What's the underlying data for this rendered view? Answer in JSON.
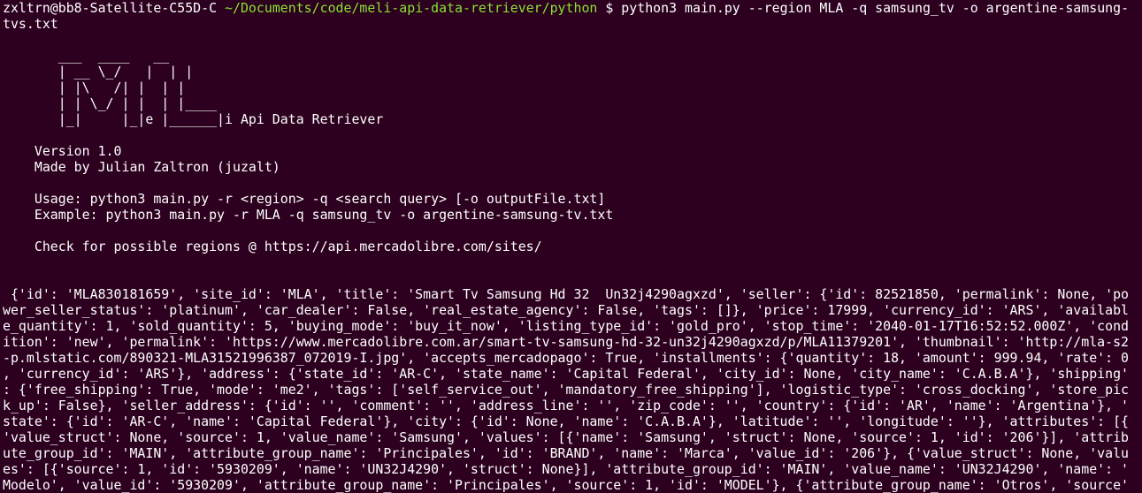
{
  "terminal": {
    "prompt_user_host": "zxltrn@bb8-Satellite-C55D-C",
    "prompt_path": "~/Documents/code/meli-api-data-retriever/python",
    "prompt_symbol": "$",
    "command": "python3 main.py --region MLA -q samsung_tv -o argentine-samsung-",
    "command_wrap": "tvs.txt",
    "banner": [
      "       ___  ____   __",
      "       | __ \\_/   |  | |",
      "       | |\\   /| |  | |",
      "       | | \\_/ | |  | |____",
      "       |_|     |_|e |______|i Api Data Retriever"
    ],
    "version": "    Version 1.0",
    "author": "    Made by Julian Zaltron (juzalt)",
    "usage": "    Usage: python3 main.py -r <region> -q <search query> [-o outputFile.txt]",
    "example": "    Example: python3 main.py -r MLA -q samsung_tv -o argentine-samsung-tv.txt",
    "regions_hint": "    Check for possible regions @ https://api.mercadolibre.com/sites/",
    "output_lines": [
      " {'id': 'MLA830181659', 'site_id': 'MLA', 'title': 'Smart Tv Samsung Hd 32  Un32j4290agxzd', 'seller': {'id': 82521850, 'permalink': None, 'po",
      "wer_seller_status': 'platinum', 'car_dealer': False, 'real_estate_agency': False, 'tags': []}, 'price': 17999, 'currency_id': 'ARS', 'availabl",
      "e_quantity': 1, 'sold_quantity': 5, 'buying_mode': 'buy_it_now', 'listing_type_id': 'gold_pro', 'stop_time': '2040-01-17T16:52:52.000Z', 'cond",
      "ition': 'new', 'permalink': 'https://www.mercadolibre.com.ar/smart-tv-samsung-hd-32-un32j4290agxzd/p/MLA11379201', 'thumbnail': 'http://mla-s2",
      "-p.mlstatic.com/890321-MLA31521996387_072019-I.jpg', 'accepts_mercadopago': True, 'installments': {'quantity': 18, 'amount': 999.94, 'rate': 0",
      ", 'currency_id': 'ARS'}, 'address': {'state_id': 'AR-C', 'state_name': 'Capital Federal', 'city_id': None, 'city_name': 'C.A.B.A'}, 'shipping'",
      ": {'free_shipping': True, 'mode': 'me2', 'tags': ['self_service_out', 'mandatory_free_shipping'], 'logistic_type': 'cross_docking', 'store_pic",
      "k_up': False}, 'seller_address': {'id': '', 'comment': '', 'address_line': '', 'zip_code': '', 'country': {'id': 'AR', 'name': 'Argentina'}, '",
      "state': {'id': 'AR-C', 'name': 'Capital Federal'}, 'city': {'id': None, 'name': 'C.A.B.A'}, 'latitude': '', 'longitude': ''}, 'attributes': [{",
      "'value_struct': None, 'source': 1, 'value_name': 'Samsung', 'values': [{'name': 'Samsung', 'struct': None, 'source': 1, 'id': '206'}], 'attrib",
      "ute_group_id': 'MAIN', 'attribute_group_name': 'Principales', 'id': 'BRAND', 'name': 'Marca', 'value_id': '206'}, {'value_struct': None, 'valu",
      "es': [{'source': 1, 'id': '5930209', 'name': 'UN32J4290', 'struct': None}], 'attribute_group_id': 'MAIN', 'value_name': 'UN32J4290', 'name': '",
      "Modelo', 'value_id': '5930209', 'attribute_group_name': 'Principales', 'source': 1, 'id': 'MODEL'}, {'attribute_group_name': 'Otros', 'source'"
    ]
  }
}
